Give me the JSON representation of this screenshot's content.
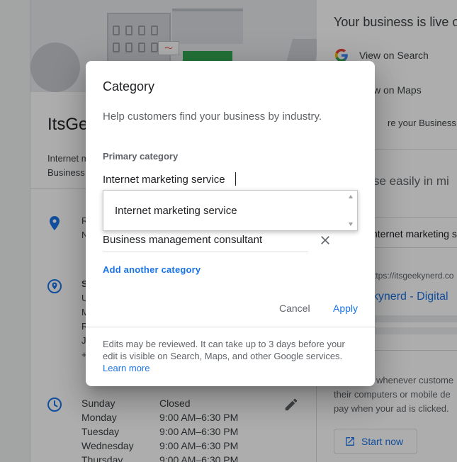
{
  "background": {
    "business_name": "ItsGe",
    "business_meta": [
      "Internet m",
      "Business"
    ],
    "address_fragments": [
      "R",
      "N"
    ],
    "service_area_fragments": [
      "S",
      "U",
      "M",
      "R",
      "J",
      "+"
    ],
    "hours": [
      {
        "day": "Sunday",
        "time": "Closed"
      },
      {
        "day": "Monday",
        "time": "9:00 AM–6:30 PM"
      },
      {
        "day": "Tuesday",
        "time": "9:00 AM–6:30 PM"
      },
      {
        "day": "Wednesday",
        "time": "9:00 AM–6:30 PM"
      },
      {
        "day": "Thursday",
        "time": "9:00 AM–6:30 PM"
      }
    ],
    "right_panel": {
      "title": "Your business is live o",
      "view_on_search": "View on Search",
      "view_on_maps": "w on Maps",
      "share_profile": "re your Business P",
      "subtitle": "se easily in mi",
      "card_text": "nternet marketing se",
      "url_text": "ttps://itsgeekynerd.co",
      "blue_text": "ekynerd - Digital",
      "ad_text_1": "whenever custome",
      "ad_text_2": "their computers or mobile de",
      "ad_text_3": "pay when your ad is clicked.",
      "start_now": "Start now"
    }
  },
  "dialog": {
    "title": "Category",
    "description": "Help customers find your business by industry.",
    "primary_label": "Primary category",
    "primary_value": "Internet marketing service",
    "secondary_value": "Business management consultant",
    "add_another": "Add another category",
    "cancel": "Cancel",
    "apply": "Apply",
    "footer_text": "Edits may be reviewed. It can take up to 3 days before your edit is visible on Search, Maps, and other Google services. ",
    "learn_more": "Learn more"
  },
  "dropdown": {
    "options": [
      "Internet marketing service"
    ]
  },
  "colors": {
    "accent": "#1a73e8",
    "overlay": "rgba(0,0,0,0.32)",
    "hero_green": "#34a853"
  }
}
